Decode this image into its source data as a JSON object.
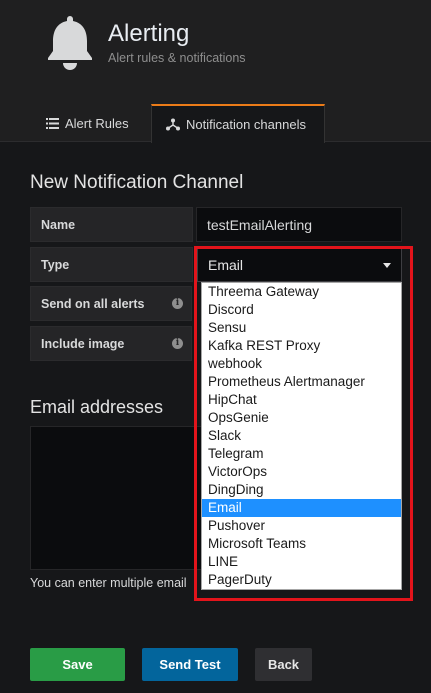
{
  "header": {
    "title": "Alerting",
    "subtitle": "Alert rules & notifications",
    "icon": "bell-icon"
  },
  "tabs": [
    {
      "label": "Alert Rules",
      "icon": "list-icon",
      "active": false
    },
    {
      "label": "Notification channels",
      "icon": "share-icon",
      "active": true
    }
  ],
  "form": {
    "section_title": "New Notification Channel",
    "name_label": "Name",
    "name_value": "testEmailAlerting",
    "type_label": "Type",
    "type_value": "Email",
    "send_all_label": "Send on all alerts",
    "include_image_label": "Include image"
  },
  "type_options": {
    "items": [
      "Threema Gateway",
      "Discord",
      "Sensu",
      "Kafka REST Proxy",
      "webhook",
      "Prometheus Alertmanager",
      "HipChat",
      "OpsGenie",
      "Slack",
      "Telegram",
      "VictorOps",
      "DingDing",
      "Email",
      "Pushover",
      "Microsoft Teams",
      "LINE",
      "PagerDuty"
    ],
    "selected": "Email"
  },
  "email": {
    "section_title": "Email addresses",
    "help_text": "You can enter multiple email"
  },
  "buttons": {
    "save": "Save",
    "send_test": "Send Test",
    "back": "Back"
  },
  "colors": {
    "accent_tab": "#eb7b18",
    "save": "#299c46",
    "send_test": "#03659c",
    "highlight": "#e3141b",
    "selected_option": "#1e90ff"
  }
}
